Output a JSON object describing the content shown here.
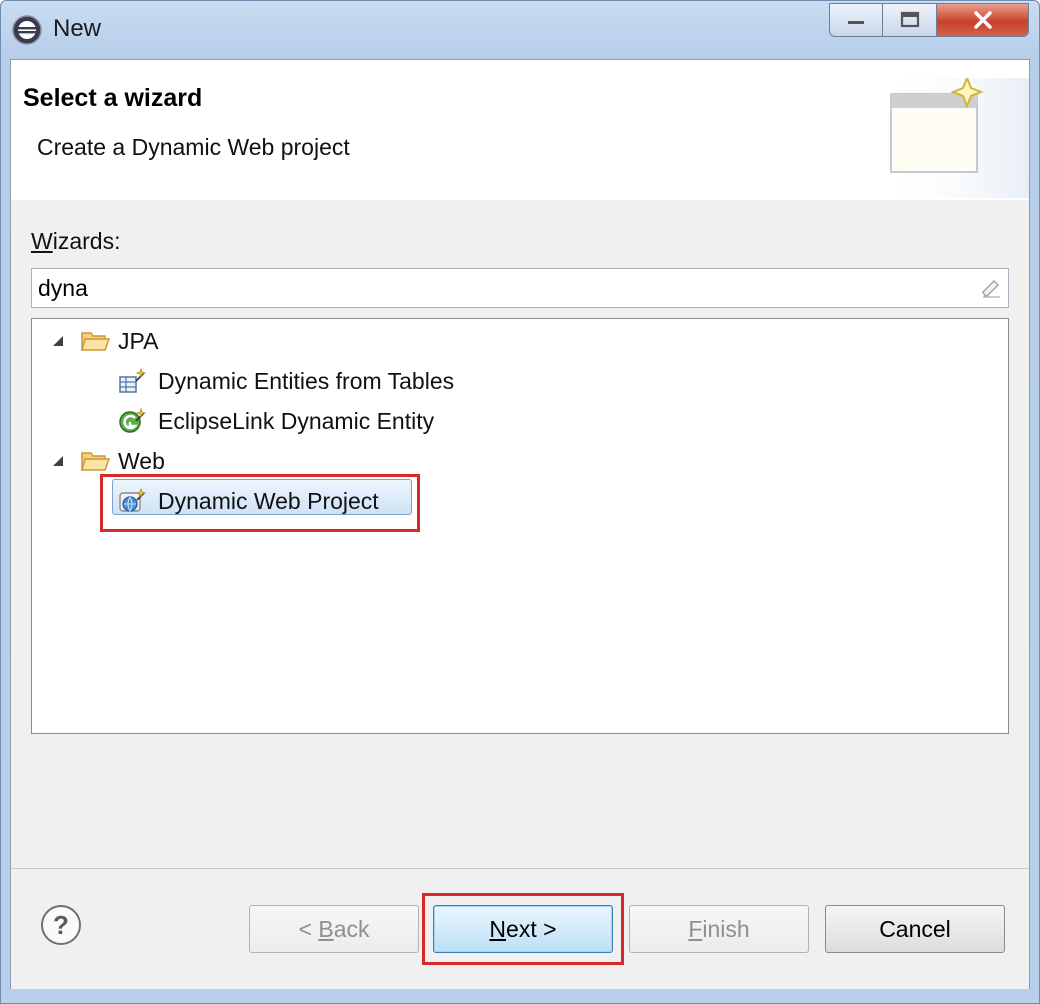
{
  "window": {
    "title": "New",
    "controls": {
      "minimize": "–",
      "maximize": "□",
      "close": "✕"
    }
  },
  "banner": {
    "title": "Select a wizard",
    "description": "Create a Dynamic Web project"
  },
  "wizards": {
    "label_mnemonic": "W",
    "label_rest": "izards:",
    "filter_value": "dyna"
  },
  "tree": {
    "items": [
      {
        "label": "JPA",
        "type": "category",
        "expanded": true,
        "icon": "folder-open-icon"
      },
      {
        "label": "Dynamic Entities from Tables",
        "type": "wizard",
        "icon": "entity-from-tables-icon"
      },
      {
        "label": "EclipseLink Dynamic Entity",
        "type": "wizard",
        "icon": "eclipselink-entity-icon"
      },
      {
        "label": "Web",
        "type": "category",
        "expanded": true,
        "icon": "folder-open-icon"
      },
      {
        "label": "Dynamic Web Project",
        "type": "wizard",
        "selected": true,
        "icon": "web-project-icon"
      }
    ]
  },
  "footer": {
    "help": "?",
    "back_prefix": "< ",
    "back_mnemonic": "B",
    "back_rest": "ack",
    "next_mnemonic": "N",
    "next_rest": "ext >",
    "finish_mnemonic": "F",
    "finish_rest": "inish",
    "cancel": "Cancel"
  },
  "colors": {
    "highlight_annotation": "#d62a2a",
    "selection": "#cfe2f7",
    "folder": "#e8b54a"
  }
}
